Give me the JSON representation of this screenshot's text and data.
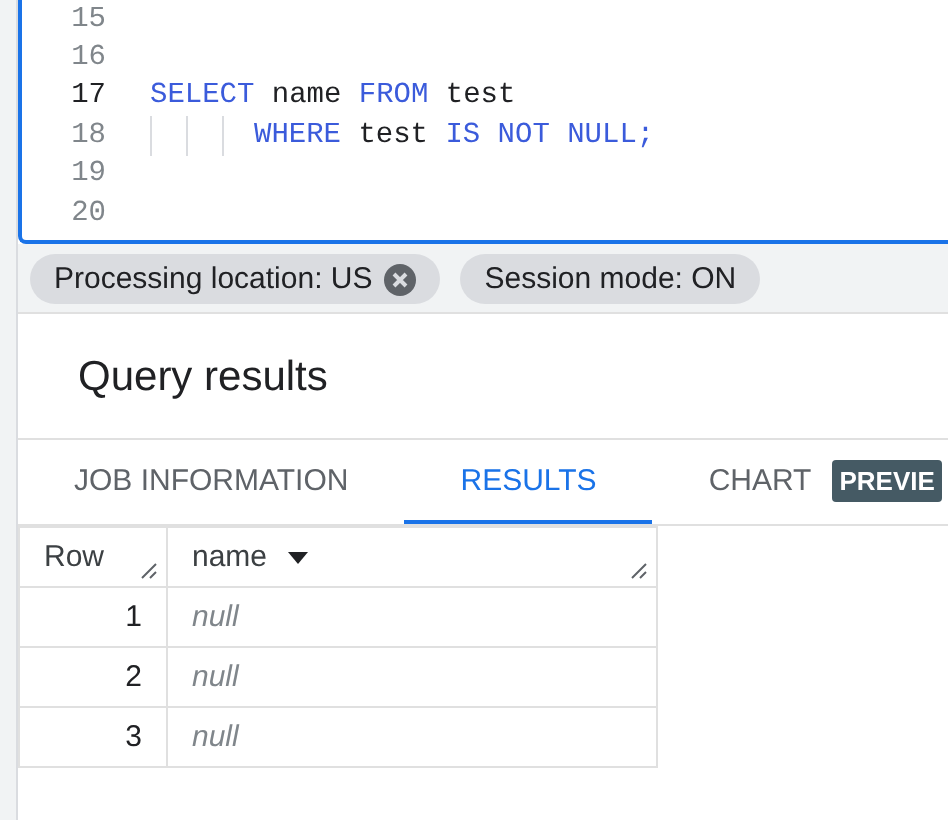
{
  "editor": {
    "lines": [
      {
        "number": "15",
        "current": false
      },
      {
        "number": "16",
        "current": false
      },
      {
        "number": "17",
        "current": true,
        "tokens": [
          {
            "text": "SELECT",
            "kind": "keyword"
          },
          {
            "text": "name",
            "kind": "ident"
          },
          {
            "text": "FROM",
            "kind": "keyword"
          },
          {
            "text": "test",
            "kind": "ident"
          }
        ]
      },
      {
        "number": "18",
        "current": false,
        "indented": true,
        "tokens": [
          {
            "text": "WHERE",
            "kind": "keyword"
          },
          {
            "text": "test",
            "kind": "ident"
          },
          {
            "text": "IS",
            "kind": "keyword"
          },
          {
            "text": "NOT",
            "kind": "keyword"
          },
          {
            "text": "NULL;",
            "kind": "keyword"
          }
        ]
      },
      {
        "number": "19",
        "current": false
      },
      {
        "number": "20",
        "current": false
      }
    ]
  },
  "chips": [
    {
      "label": "Processing location: US",
      "removable": true
    },
    {
      "label": "Session mode: ON",
      "removable": false
    }
  ],
  "results": {
    "title": "Query results",
    "tabs": [
      {
        "label": "JOB INFORMATION",
        "selected": false
      },
      {
        "label": "RESULTS",
        "selected": true
      },
      {
        "label": "CHART",
        "selected": false,
        "badge": "PREVIE"
      }
    ],
    "table": {
      "columns": [
        {
          "label": "Row",
          "sortable": false
        },
        {
          "label": "name",
          "sortable": true
        }
      ],
      "rows": [
        {
          "row": "1",
          "name": "null"
        },
        {
          "row": "2",
          "name": "null"
        },
        {
          "row": "3",
          "name": "null"
        }
      ]
    }
  }
}
